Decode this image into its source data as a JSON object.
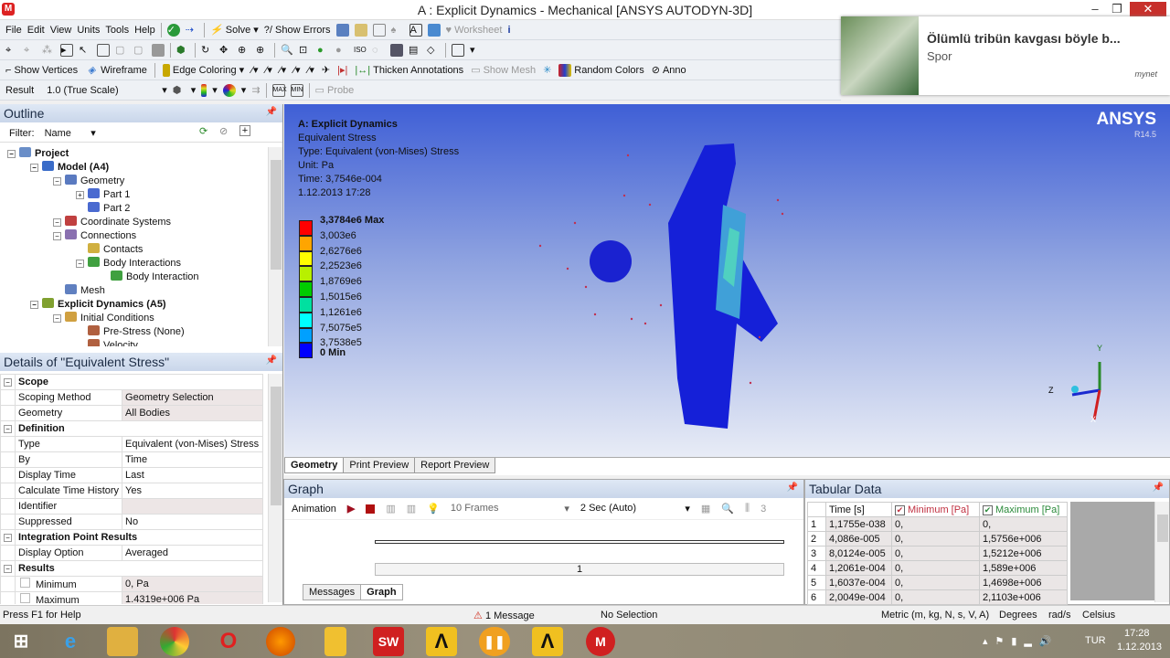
{
  "window": {
    "title": "A : Explicit Dynamics - Mechanical [ANSYS AUTODYN-3D]",
    "app_icon": "M"
  },
  "menu": [
    "File",
    "Edit",
    "View",
    "Units",
    "Tools",
    "Help"
  ],
  "toolbar1": {
    "solve": "Solve",
    "show_errors": "?/ Show Errors",
    "worksheet": "Worksheet"
  },
  "toolbar3": {
    "show_vertices": "Show Vertices",
    "wireframe": "Wireframe",
    "edge_coloring": "Edge Coloring",
    "thicken_annotations": "Thicken Annotations",
    "show_mesh": "Show Mesh",
    "random_colors": "Random Colors",
    "annotation": "Anno"
  },
  "toolbar4": {
    "result_label": "Result",
    "scale": "1.0 (True Scale)",
    "probe": "Probe"
  },
  "notification": {
    "title": "Ölümlü tribün kavgası böyle b...",
    "source": "Spor",
    "brand": "mynet"
  },
  "outline": {
    "title": "Outline",
    "filter_label": "Filter:",
    "filter_value": "Name",
    "tree": [
      {
        "label": "Project",
        "level": 0,
        "bold": true,
        "color": "#6a8ec8"
      },
      {
        "label": "Model (A4)",
        "level": 1,
        "bold": true,
        "color": "#3a6cc8"
      },
      {
        "label": "Geometry",
        "level": 2,
        "color": "#5a7ac0"
      },
      {
        "label": "Part 1",
        "level": 3,
        "color": "#4a6ad0"
      },
      {
        "label": "Part 2",
        "level": 3,
        "color": "#4a6ad0"
      },
      {
        "label": "Coordinate Systems",
        "level": 2,
        "color": "#c04040"
      },
      {
        "label": "Connections",
        "level": 2,
        "color": "#8a70b0"
      },
      {
        "label": "Contacts",
        "level": 3,
        "color": "#d0b040"
      },
      {
        "label": "Body Interactions",
        "level": 3,
        "color": "#40a040"
      },
      {
        "label": "Body Interaction",
        "level": 4,
        "color": "#40a040"
      },
      {
        "label": "Mesh",
        "level": 2,
        "color": "#6080c0"
      },
      {
        "label": "Explicit Dynamics (A5)",
        "level": 1,
        "bold": true,
        "color": "#80a030"
      },
      {
        "label": "Initial Conditions",
        "level": 2,
        "color": "#d0a040"
      },
      {
        "label": "Pre-Stress (None)",
        "level": 3,
        "color": "#b06040"
      },
      {
        "label": "Velocity",
        "level": 3,
        "color": "#b06040"
      }
    ]
  },
  "details": {
    "title": "Details of \"Equivalent Stress\"",
    "rows": [
      {
        "section": "Scope"
      },
      {
        "k": "Scoping Method",
        "v": "Geometry Selection",
        "shade": true
      },
      {
        "k": "Geometry",
        "v": "All Bodies",
        "shade": true
      },
      {
        "section": "Definition"
      },
      {
        "k": "Type",
        "v": "Equivalent (von-Mises) Stress"
      },
      {
        "k": "By",
        "v": "Time"
      },
      {
        "k": "Display Time",
        "v": "Last"
      },
      {
        "k": "Calculate Time History",
        "v": "Yes"
      },
      {
        "k": "Identifier",
        "v": "",
        "shade": true
      },
      {
        "k": "Suppressed",
        "v": "No"
      },
      {
        "section": "Integration Point Results"
      },
      {
        "k": "Display Option",
        "v": "Averaged"
      },
      {
        "section": "Results"
      },
      {
        "k": "Minimum",
        "v": "0, Pa",
        "shade": true,
        "check": true
      },
      {
        "k": "Maximum",
        "v": "1.4319e+006 Pa",
        "shade": true,
        "check": true
      }
    ]
  },
  "viewport": {
    "heading": "A: Explicit Dynamics",
    "result": "Equivalent Stress",
    "type": "Type: Equivalent (von-Mises) Stress",
    "unit": "Unit: Pa",
    "time": "Time: 3,7546e-004",
    "date": "1.12.2013 17:28",
    "brand": "ANSYS",
    "version": "R14.5",
    "legend": [
      {
        "label": "3,3784e6 Max",
        "color": "#ff0000"
      },
      {
        "label": "3,003e6",
        "color": "#ffa500"
      },
      {
        "label": "2,6276e6",
        "color": "#ffff00"
      },
      {
        "label": "2,2523e6",
        "color": "#b8f000"
      },
      {
        "label": "1,8769e6",
        "color": "#00cc00"
      },
      {
        "label": "1,5015e6",
        "color": "#00e0a0"
      },
      {
        "label": "1,1261e6",
        "color": "#00ffff"
      },
      {
        "label": "7,5075e5",
        "color": "#00a0ff"
      },
      {
        "label": "3,7538e5",
        "color": "#0000ff"
      },
      {
        "label": "0 Min",
        "color": ""
      }
    ],
    "axes": {
      "x": "X",
      "y": "Y",
      "z": "Z"
    }
  },
  "view_tabs": [
    "Geometry",
    "Print Preview",
    "Report Preview"
  ],
  "graph": {
    "title": "Graph",
    "animation": "Animation",
    "frames": "10 Frames",
    "duration": "2 Sec (Auto)",
    "frame_index": "1",
    "tail": "3",
    "tabs": [
      "Messages",
      "Graph"
    ]
  },
  "tabular": {
    "title": "Tabular Data",
    "headers": [
      "Time [s]",
      "Minimum [Pa]",
      "Maximum [Pa]"
    ],
    "rows": [
      [
        "1",
        "1,1755e-038",
        "0,",
        "0,"
      ],
      [
        "2",
        "4,086e-005",
        "0,",
        "1,5756e+006"
      ],
      [
        "3",
        "8,0124e-005",
        "0,",
        "1,5212e+006"
      ],
      [
        "4",
        "1,2061e-004",
        "0,",
        "1,589e+006"
      ],
      [
        "5",
        "1,6037e-004",
        "0,",
        "1,4698e+006"
      ],
      [
        "6",
        "2,0049e-004",
        "0,",
        "2,1103e+006"
      ]
    ]
  },
  "status": {
    "help": "Press F1 for Help",
    "messages": "1 Message",
    "selection": "No Selection",
    "units": "Metric (m, kg, N, s, V, A)",
    "angle": "Degrees",
    "rot": "rad/s",
    "temp": "Celsius"
  },
  "taskbar": {
    "lang": "TUR",
    "time": "17:28",
    "date": "1.12.2013",
    "apps": [
      "ie",
      "explorer",
      "chrome",
      "opera",
      "firefox",
      "notes",
      "SW",
      "autodyn",
      "media",
      "autodyn",
      "M"
    ]
  }
}
